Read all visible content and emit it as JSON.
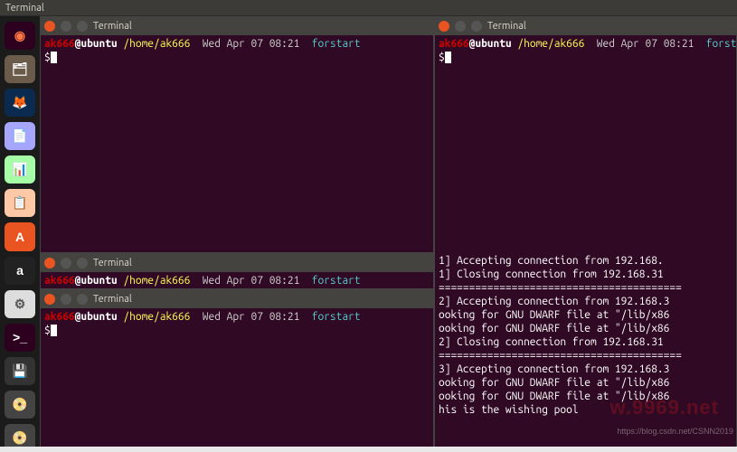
{
  "topbar": {
    "title": "Terminal"
  },
  "launcher": {
    "apps": [
      {
        "name": "ubuntu-dash",
        "bg": "#2c001e",
        "glyph": "◉",
        "fg": "#ff7744"
      },
      {
        "name": "files",
        "bg": "#6b5b4b",
        "glyph": "🗂",
        "fg": "#fff"
      },
      {
        "name": "firefox",
        "bg": "#0a2a4f",
        "glyph": "🦊",
        "fg": "#ff7f00"
      },
      {
        "name": "writer",
        "bg": "#a6a6ff",
        "glyph": "📄",
        "fg": "#2c64b4"
      },
      {
        "name": "calc",
        "bg": "#a6ffa6",
        "glyph": "📊",
        "fg": "#2e8b2e"
      },
      {
        "name": "impress",
        "bg": "#ffc8a6",
        "glyph": "📋",
        "fg": "#d05a3c"
      },
      {
        "name": "software-center",
        "bg": "#e95420",
        "glyph": "A",
        "fg": "#fff"
      },
      {
        "name": "amazon",
        "bg": "#222",
        "glyph": "a",
        "fg": "#fff"
      },
      {
        "name": "settings",
        "bg": "#ddd",
        "glyph": "⚙",
        "fg": "#555"
      },
      {
        "name": "terminal",
        "bg": "#2c001e",
        "glyph": ">_",
        "fg": "#fff"
      },
      {
        "name": "disk",
        "bg": "#333",
        "glyph": "💾",
        "fg": "#fff"
      },
      {
        "name": "dvd1",
        "bg": "#444",
        "glyph": "📀",
        "fg": "#bbb"
      },
      {
        "name": "dvd2",
        "bg": "#444",
        "glyph": "📀",
        "fg": "#bbb"
      }
    ]
  },
  "terminals": {
    "tl": {
      "title": "Terminal",
      "user": "ak666",
      "at": "@",
      "host": "ubuntu",
      "path": "/home/ak666",
      "date": "Wed Apr 07 08:21",
      "cmd": "forstart",
      "prompt": "$"
    },
    "tr": {
      "title": "Terminal",
      "user": "ak666",
      "at": "@",
      "host": "ubuntu",
      "path": "/home/ak666",
      "date": "Wed Apr 07 08:21",
      "cmd": "forstart",
      "prompt": "$",
      "output": "1] Accepting connection from 192.168.\n1] Closing connection from 192.168.31\n========================================\n2] Accepting connection from 192.168.3\nooking for GNU DWARF file at \"/lib/x86\nooking for GNU DWARF file at \"/lib/x86\n2] Closing connection from 192.168.31\n========================================\n3] Accepting connection from 192.168.3\nooking for GNU DWARF file at \"/lib/x86\nooking for GNU DWARF file at \"/lib/x86\nhis is the wishing pool"
    },
    "ml": {
      "title": "Terminal",
      "user": "ak666",
      "at": "@",
      "host": "ubuntu",
      "path": "/home/ak666",
      "date": "Wed Apr 07 08:21",
      "cmd": "forstart"
    },
    "bl": {
      "title": "Terminal",
      "user": "ak666",
      "at": "@",
      "host": "ubuntu",
      "path": "/home/ak666",
      "date": "Wed Apr 07 08:21",
      "cmd": "forstart",
      "prompt": "$"
    }
  },
  "watermark": "w.9969.net",
  "urlmark": "https://blog.csdn.net/CSNN2019"
}
